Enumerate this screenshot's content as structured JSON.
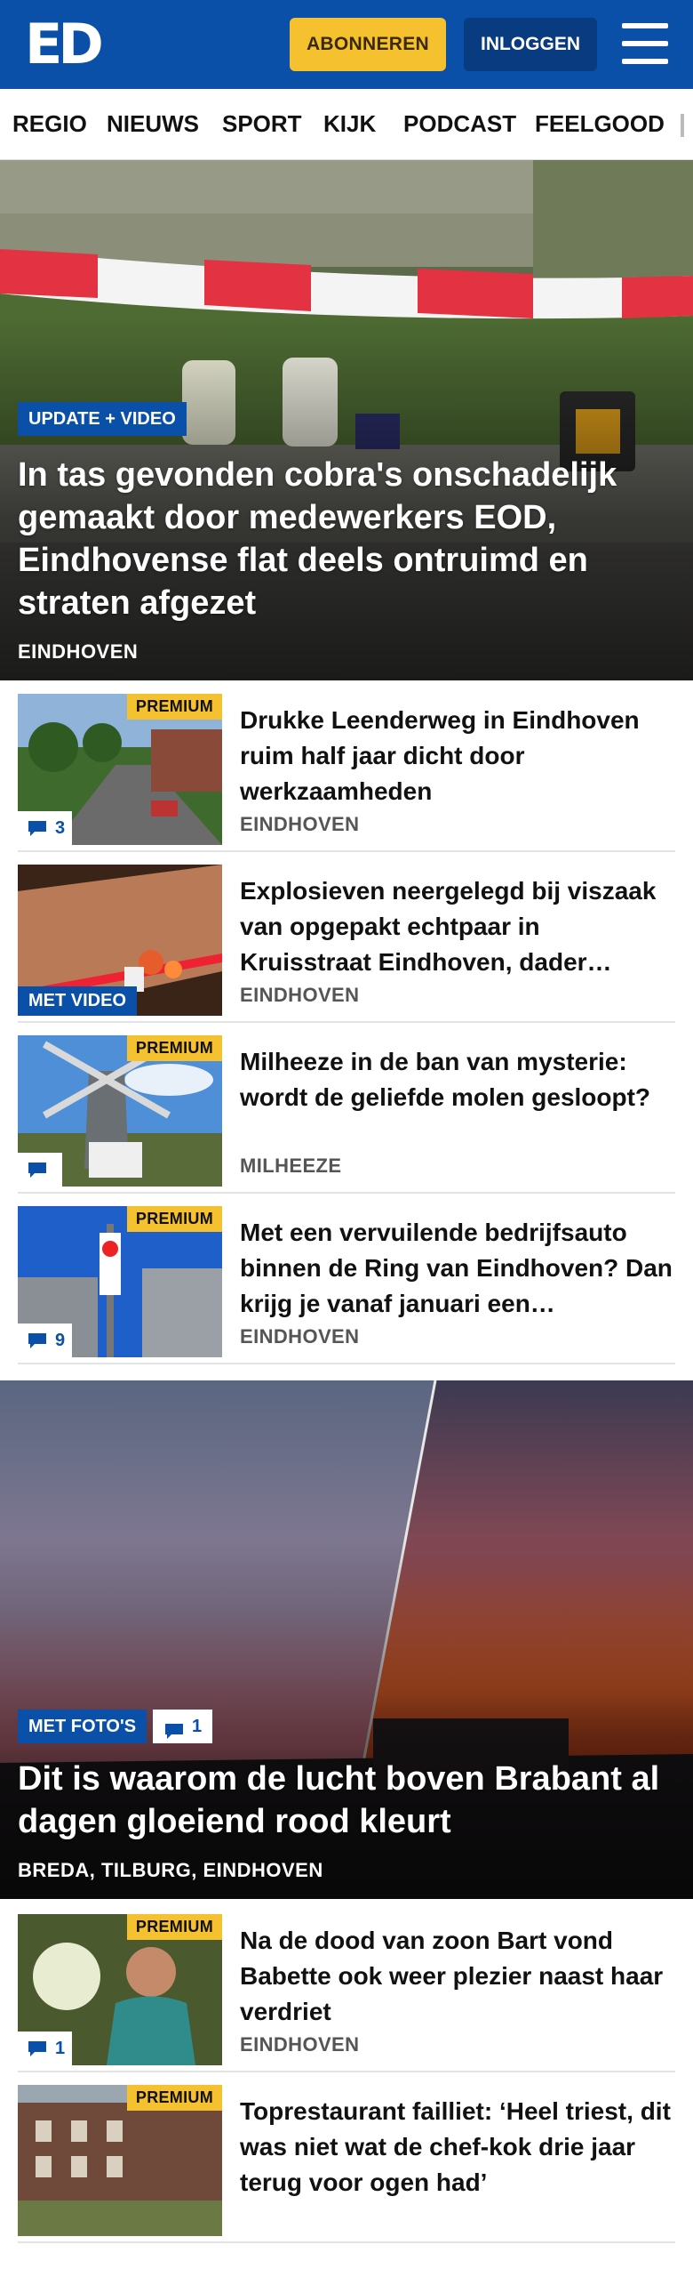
{
  "header": {
    "logo": "ED",
    "subscribe_label": "ABONNEREN",
    "login_label": "INLOGGEN"
  },
  "nav": {
    "items": [
      "REGIO",
      "NIEUWS",
      "SPORT",
      "KIJK",
      "PODCAST",
      "FEELGOOD"
    ]
  },
  "hero1": {
    "tag": "UPDATE + VIDEO",
    "title": "In tas gevonden cobra's onschadelijk gemaakt door medewerkers EOD, Eindhovense flat deels ontruimd en straten afgezet",
    "place": "EINDHOVEN"
  },
  "articles": [
    {
      "title": "Drukke Leenderweg in Eindhoven ruim half jaar dicht door werkzaamheden",
      "place": "EINDHOVEN",
      "premium": "PREMIUM",
      "comments": "3"
    },
    {
      "title": "Explosieven neergelegd bij viszaak van opgepakt echtpaar in Kruisstraat Eindhoven, dader…",
      "place": "EINDHOVEN",
      "video": "MET VIDEO"
    },
    {
      "title": "Milheeze in de ban van mysterie: wordt de geliefde molen gesloopt?",
      "place": "MILHEEZE",
      "premium": "PREMIUM",
      "comments": ""
    },
    {
      "title": "Met een vervuilende bedrijfsauto binnen de Ring van Eindhoven? Dan krijg je vanaf januari een…",
      "place": "EINDHOVEN",
      "premium": "PREMIUM",
      "comments": "9"
    }
  ],
  "hero2": {
    "tag": "MET FOTO'S",
    "comments": "1",
    "title": "Dit is waarom de lucht boven Brabant al dagen gloeiend rood kleurt",
    "place": "BREDA, TILBURG, EINDHOVEN"
  },
  "articles2": [
    {
      "title": "Na de dood van zoon Bart vond Babette ook weer plezier naast haar verdriet",
      "place": "EINDHOVEN",
      "premium": "PREMIUM",
      "comments": "1"
    },
    {
      "title": "Toprestaurant failliet: ‘Heel triest, dit was niet wat de chef-kok drie jaar terug voor ogen had’",
      "place": "",
      "premium": "PREMIUM"
    }
  ],
  "colors": {
    "brand_blue": "#0a4fa8",
    "premium_yellow": "#f5c12e",
    "login_navy": "#083b80"
  }
}
